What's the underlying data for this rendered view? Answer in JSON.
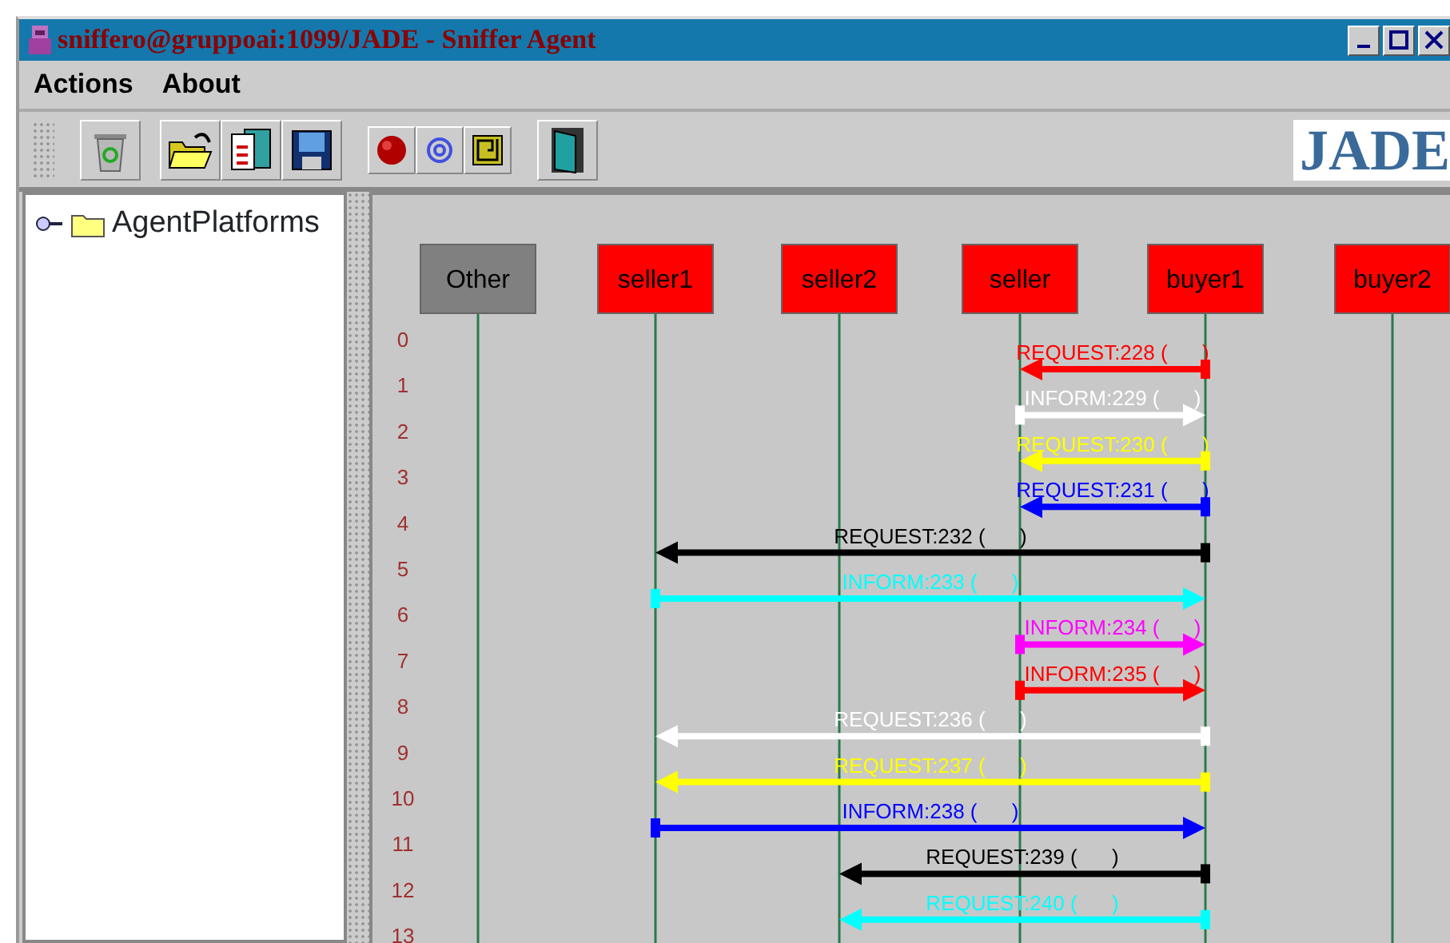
{
  "window": {
    "title": "sniffero@gruppoai:1099/JADE - Sniffer Agent"
  },
  "menu": [
    "Actions",
    "About"
  ],
  "toolbar": {
    "logo": "JADE"
  },
  "tree": {
    "items": [
      {
        "label": "AgentPlatforms",
        "expanded": false
      }
    ]
  },
  "agents": [
    {
      "name": "Other",
      "color": "#808080"
    },
    {
      "name": "seller1",
      "color": "#ff0000"
    },
    {
      "name": "seller2",
      "color": "#ff0000"
    },
    {
      "name": "seller",
      "color": "#ff0000"
    },
    {
      "name": "buyer1",
      "color": "#ff0000"
    },
    {
      "name": "buyer2",
      "color": "#ff0000"
    }
  ],
  "row_numbers": [
    "0",
    "1",
    "2",
    "3",
    "4",
    "5",
    "6",
    "7",
    "8",
    "9",
    "10",
    "11",
    "12",
    "13"
  ],
  "messages": [
    {
      "label": "REQUEST:228 (      )",
      "color": "#ff0000"
    },
    {
      "label": "INFORM:229 (      )",
      "color": "#ffffff"
    },
    {
      "label": "REQUEST:230 (      )",
      "color": "#ffff00"
    },
    {
      "label": "REQUEST:231 (      )",
      "color": "#0000ff"
    },
    {
      "label": "REQUEST:232 (      )",
      "color": "#000000"
    },
    {
      "label": "INFORM:233 (      )",
      "color": "#00ffff"
    },
    {
      "label": "INFORM:234 (      )",
      "color": "#ff00ff"
    },
    {
      "label": "INFORM:235 (      )",
      "color": "#ff0000"
    },
    {
      "label": "REQUEST:236 (      )",
      "color": "#ffffff"
    },
    {
      "label": "REQUEST:237 (      )",
      "color": "#ffff00"
    },
    {
      "label": "INFORM:238 (      )",
      "color": "#0000ff"
    },
    {
      "label": "REQUEST:239 (      )",
      "color": "#000000"
    },
    {
      "label": "REQUEST:240 (      )",
      "color": "#00ffff"
    }
  ]
}
